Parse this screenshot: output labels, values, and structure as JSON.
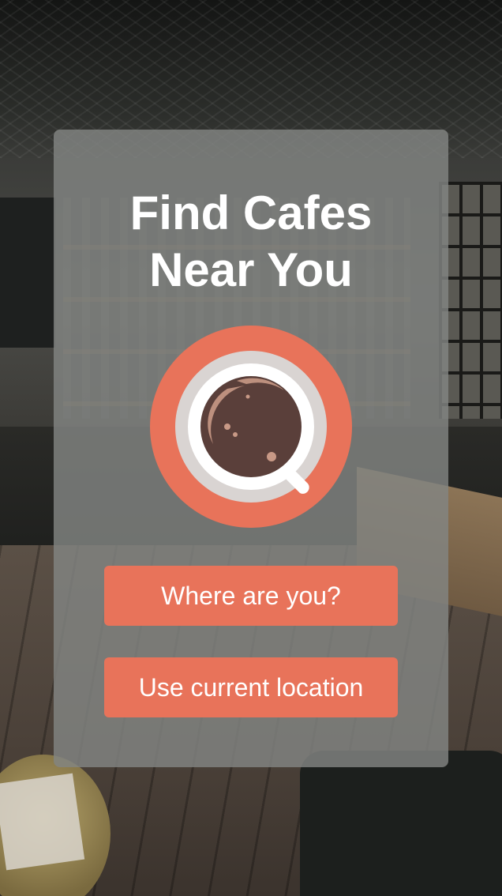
{
  "card": {
    "title_line1": "Find Cafes",
    "title_line2": "Near You"
  },
  "logo": {
    "icon": "coffee-cup-icon",
    "colors": {
      "ring": "#e8735a",
      "saucer": "#d9d4d2",
      "cup": "#ffffff",
      "coffee": "#5a3f3a",
      "foam": "#c89986"
    }
  },
  "buttons": {
    "where_label": "Where are you?",
    "current_location_label": "Use current location"
  },
  "colors": {
    "accent": "#e8735a",
    "card_background": "#828583",
    "text": "#ffffff"
  }
}
